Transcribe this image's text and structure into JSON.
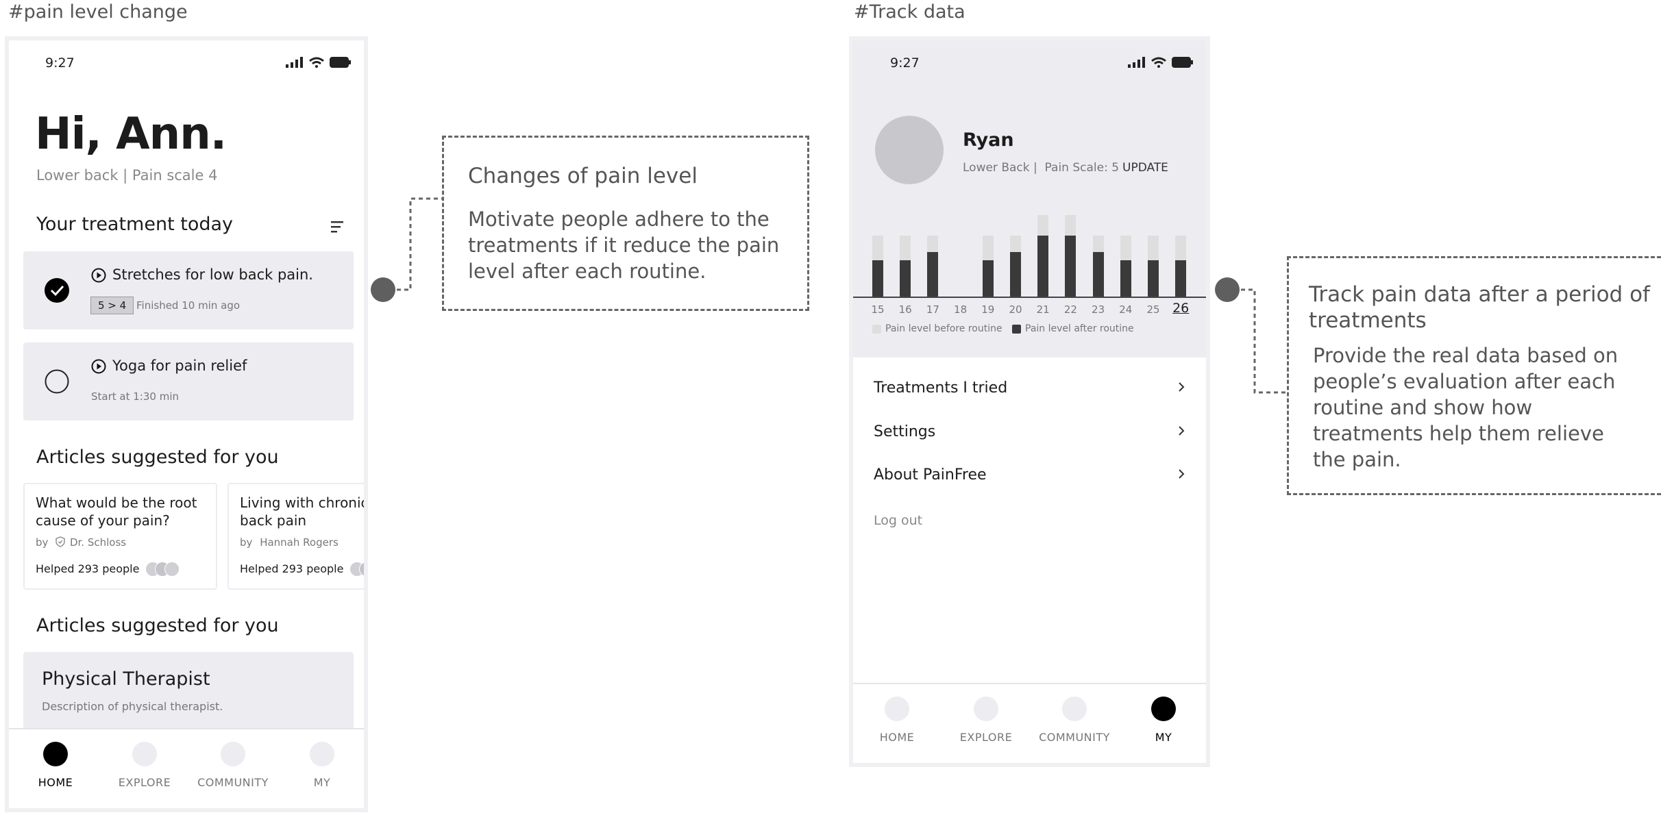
{
  "labels": {
    "left": "#pain level change",
    "right": "#Track data"
  },
  "left_phone": {
    "time": "9:27",
    "greeting": "Hi, Ann.",
    "subtitle": "Lower back | Pain scale 4",
    "treatment_heading": "Your treatment today",
    "treatments": [
      {
        "title": "Stretches for low back pain.",
        "badge": "5 > 4",
        "meta": "Finished 10 min ago",
        "done": true
      },
      {
        "title": "Yoga for pain relief",
        "meta": "Start at 1:30 min",
        "done": false
      }
    ],
    "articles_heading": "Articles suggested for you",
    "articles": [
      {
        "title": "What would be the root cause of your pain?",
        "by": "by",
        "author": "Dr. Schloss",
        "helped": "Helped 293 people"
      },
      {
        "title": "Living with chronic back pain",
        "by": "by",
        "author": "Hannah Rogers",
        "helped": "Helped 293 people"
      }
    ],
    "articles_heading_2": "Articles suggested for you",
    "therapist": {
      "title": "Physical Therapist",
      "desc": "Description of physical therapist."
    },
    "nav": [
      "HOME",
      "EXPLORE",
      "COMMUNITY",
      "MY"
    ]
  },
  "callout_left": {
    "title": "Changes of pain level",
    "body": "Motivate people adhere to the treatments if it reduce the pain level after each routine."
  },
  "right_phone": {
    "time": "9:27",
    "name": "Ryan",
    "meta": "Lower Back |  Pain Scale: 5",
    "update": "UPDATE",
    "legend_before": "Pain level before routine",
    "legend_after": "Pain level after routine",
    "menu": [
      "Treatments I tried",
      "Settings",
      "About PainFree"
    ],
    "logout": "Log out",
    "nav": [
      "HOME",
      "EXPLORE",
      "COMMUNITY",
      "MY"
    ]
  },
  "chart_data": {
    "type": "bar",
    "categories": [
      "15",
      "16",
      "17",
      "18",
      "19",
      "20",
      "21",
      "22",
      "23",
      "24",
      "25",
      "26"
    ],
    "series": [
      {
        "name": "Pain level before routine",
        "values": [
          3,
          3,
          3,
          0,
          3,
          3,
          4,
          4,
          3,
          3,
          3,
          3
        ]
      },
      {
        "name": "Pain level after routine",
        "values": [
          1.8,
          1.8,
          2.2,
          0,
          1.8,
          2.2,
          3,
          3,
          2.2,
          1.8,
          1.8,
          1.8
        ]
      }
    ],
    "ylim": [
      0,
      4
    ],
    "highlight": "26",
    "colors": {
      "before": "#dededf",
      "after": "#3a3a3a"
    }
  },
  "callout_right": {
    "title": "Track pain data after a period of treatments",
    "body": "Provide the real data based on people’s evaluation after each routine and show how treatments help them relieve the pain."
  }
}
